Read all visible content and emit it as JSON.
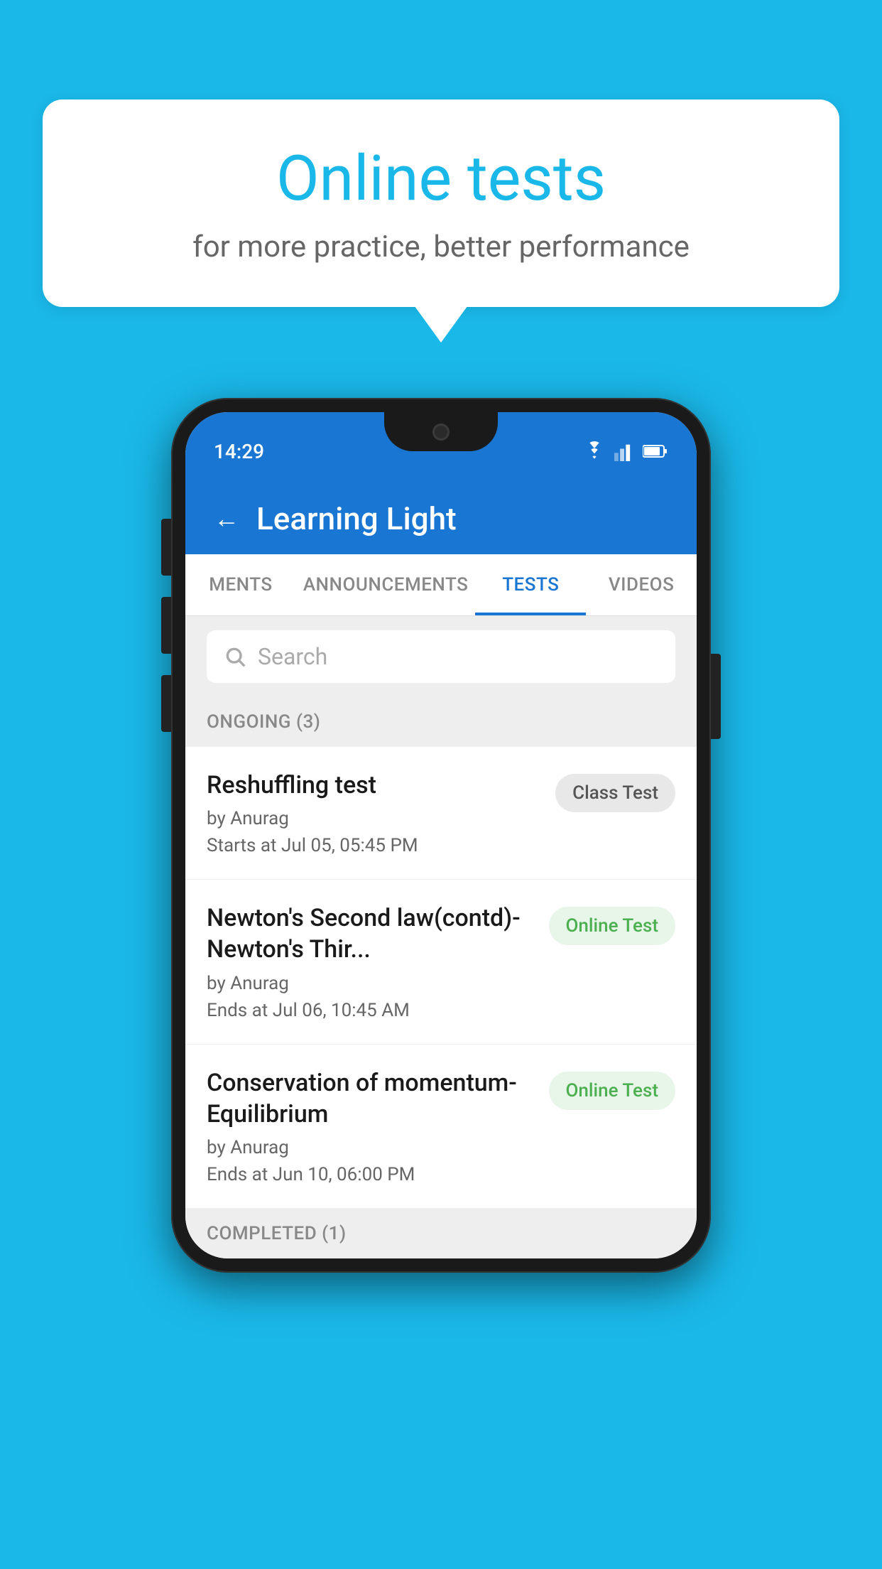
{
  "background": {
    "color": "#1ab8e8"
  },
  "speech_bubble": {
    "title": "Online tests",
    "subtitle": "for more practice, better performance"
  },
  "phone": {
    "status_bar": {
      "time": "14:29",
      "icons": [
        "wifi",
        "signal",
        "battery"
      ]
    },
    "app_header": {
      "title": "Learning Light",
      "back_label": "←"
    },
    "tabs": [
      {
        "label": "MENTS",
        "active": false
      },
      {
        "label": "ANNOUNCEMENTS",
        "active": false
      },
      {
        "label": "TESTS",
        "active": true
      },
      {
        "label": "VIDEOS",
        "active": false
      }
    ],
    "search": {
      "placeholder": "Search"
    },
    "sections": [
      {
        "title": "ONGOING (3)",
        "tests": [
          {
            "name": "Reshuffling test",
            "author": "by Anurag",
            "time_label": "Starts at",
            "time_value": "Jul 05, 05:45 PM",
            "badge": "Class Test",
            "badge_type": "class"
          },
          {
            "name": "Newton's Second law(contd)-Newton's Thir...",
            "author": "by Anurag",
            "time_label": "Ends at",
            "time_value": "Jul 06, 10:45 AM",
            "badge": "Online Test",
            "badge_type": "online"
          },
          {
            "name": "Conservation of momentum-Equilibrium",
            "author": "by Anurag",
            "time_label": "Ends at",
            "time_value": "Jun 10, 06:00 PM",
            "badge": "Online Test",
            "badge_type": "online"
          }
        ]
      }
    ],
    "completed_section": {
      "title": "COMPLETED (1)"
    }
  }
}
